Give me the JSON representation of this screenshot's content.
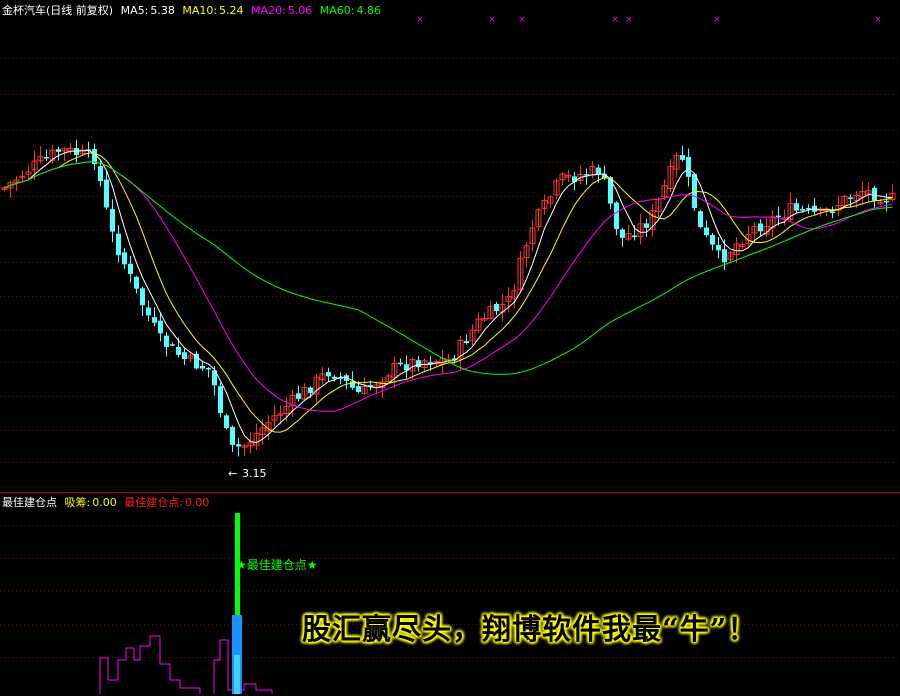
{
  "header": {
    "stock_title": "金杯汽车(日线 前复权)",
    "ma5": {
      "label": "MA5:",
      "value": "5.38",
      "color": "#ffffff"
    },
    "ma10": {
      "label": "MA10:",
      "value": "5.24",
      "color": "#ffff00"
    },
    "ma20": {
      "label": "MA20:",
      "value": "5.06",
      "color": "#ff00ff"
    },
    "ma60": {
      "label": "MA60:",
      "value": "4.86",
      "color": "#00ff00"
    }
  },
  "indicator_header": {
    "name": "最佳建仓点",
    "xichou": {
      "label": "吸筹:",
      "value": "0.00",
      "color": "#ffff00"
    },
    "best": {
      "label": "最佳建仓点:",
      "value": "0.00",
      "color": "#ff2020"
    }
  },
  "annotations": {
    "low_price_label": "3.15",
    "signal_label": "★最佳建仓点★"
  },
  "banner_text": "股汇赢尽头，翔博软件我最“牛”！",
  "colors": {
    "background": "#000000",
    "up_candle": "#ff3232",
    "down_candle": "#54ffff",
    "grid": "#7a0000",
    "divider": "#c00000",
    "signal_bar": "#00ff00",
    "accumulation_line": "#ff00ff",
    "marker": "#ff00ff"
  }
}
